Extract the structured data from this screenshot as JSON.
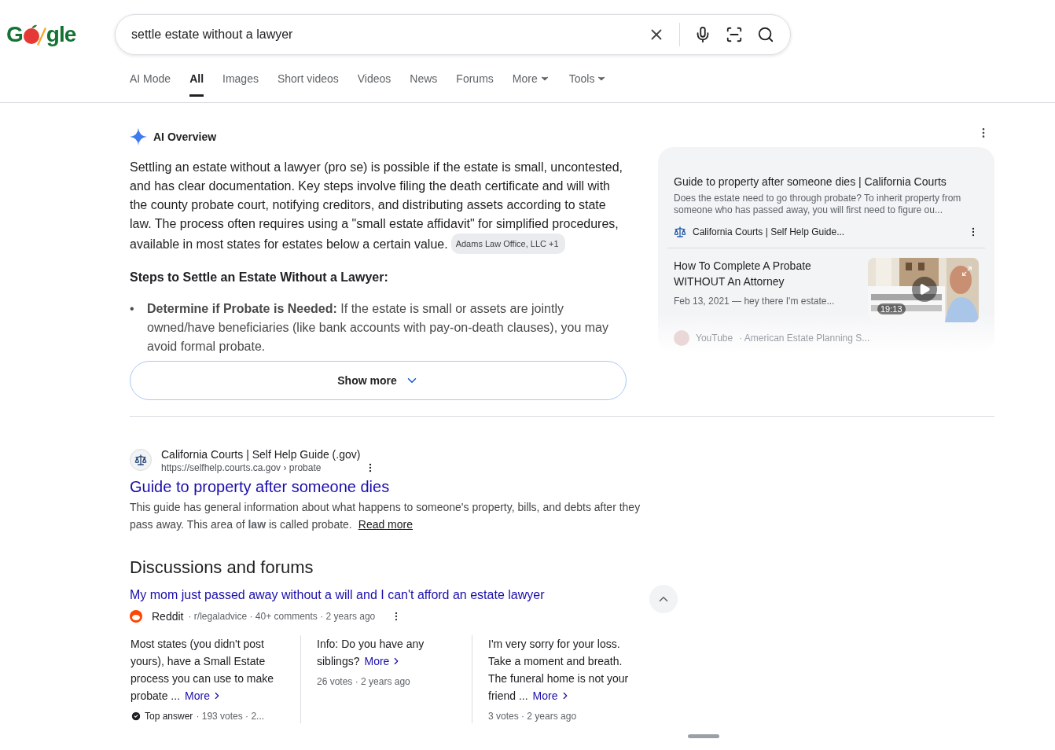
{
  "header": {
    "logo": {
      "start": "G",
      "end": "gle"
    },
    "search": {
      "value": "settle estate without a lawyer"
    },
    "tabs": [
      {
        "label": "AI Mode",
        "selected": false,
        "dropdown": false
      },
      {
        "label": "All",
        "selected": true,
        "dropdown": false
      },
      {
        "label": "Images",
        "selected": false,
        "dropdown": false
      },
      {
        "label": "Short videos",
        "selected": false,
        "dropdown": false
      },
      {
        "label": "Videos",
        "selected": false,
        "dropdown": false
      },
      {
        "label": "News",
        "selected": false,
        "dropdown": false
      },
      {
        "label": "Forums",
        "selected": false,
        "dropdown": false
      },
      {
        "label": "More",
        "selected": false,
        "dropdown": true
      },
      {
        "label": "Tools",
        "selected": false,
        "dropdown": true
      }
    ]
  },
  "ai_overview": {
    "title": "AI Overview",
    "paragraph": "Settling an estate without a lawyer (pro se) is possible if the estate is small, uncontested, and has clear documentation. Key steps involve filing the death certificate and will with the county probate court, notifying creditors, and distributing assets according to state law. The process often requires using a \"small estate affidavit\" for simplified procedures, available in most states for estates below a certain value.",
    "citation": "Adams Law Office, LLC +1",
    "heading": "Steps to Settle an Estate Without a Lawyer:",
    "bullets": [
      {
        "marker": "•",
        "term": "Determine if Probate is Needed:",
        "text": "If the estate is small or assets are jointly owned/have beneficiaries (like bank accounts with pay-on-death clauses), you may avoid formal probate."
      }
    ],
    "show_more": "Show more"
  },
  "sources": {
    "items": [
      {
        "kind": "article",
        "title": "Guide to property after someone dies | California Courts",
        "snippet": "Does the estate need to go through probate? To inherit property from someone who has passed away, you will first need to figure ou...",
        "source": "California Courts | Self Help Guide..."
      },
      {
        "kind": "video",
        "title": "How To Complete A Probate WITHOUT An Attorney",
        "meta": "Feb 13, 2021 — hey there I'm estate...",
        "duration": "19:13"
      }
    ],
    "faded_source": {
      "site": "YouTube",
      "channel": "· American Estate Planning S..."
    }
  },
  "result": {
    "site": "California Courts | Self Help Guide (.gov)",
    "url": "https://selfhelp.courts.ca.gov › probate",
    "title": "Guide to property after someone dies",
    "snippet": "This guide has general information about what happens to someone's property, bills, and debts after they pass away. This area of **law** is called probate.",
    "read_more": "Read more"
  },
  "discussions": {
    "heading": "Discussions and forums",
    "thread": {
      "title": "My mom just passed away without a will and I can't afford an estate lawyer",
      "site": "Reddit",
      "meta": "· r/legaladvice · 40+ comments · 2 years ago"
    },
    "answers": [
      {
        "text": "Most states (you didn't post yours), have a Small Estate process you can use to make probate ...",
        "more": "More",
        "badge": "Top answer",
        "meta": "· 193 votes · 2..."
      },
      {
        "text": "Info: Do you have any siblings?",
        "more": "More",
        "meta": "26 votes · 2 years ago"
      },
      {
        "text": "I'm very sorry for your loss. Take a moment and breath. The funeral home is not your friend ...",
        "more": "More",
        "meta": "3 votes · 2 years ago"
      }
    ]
  }
}
